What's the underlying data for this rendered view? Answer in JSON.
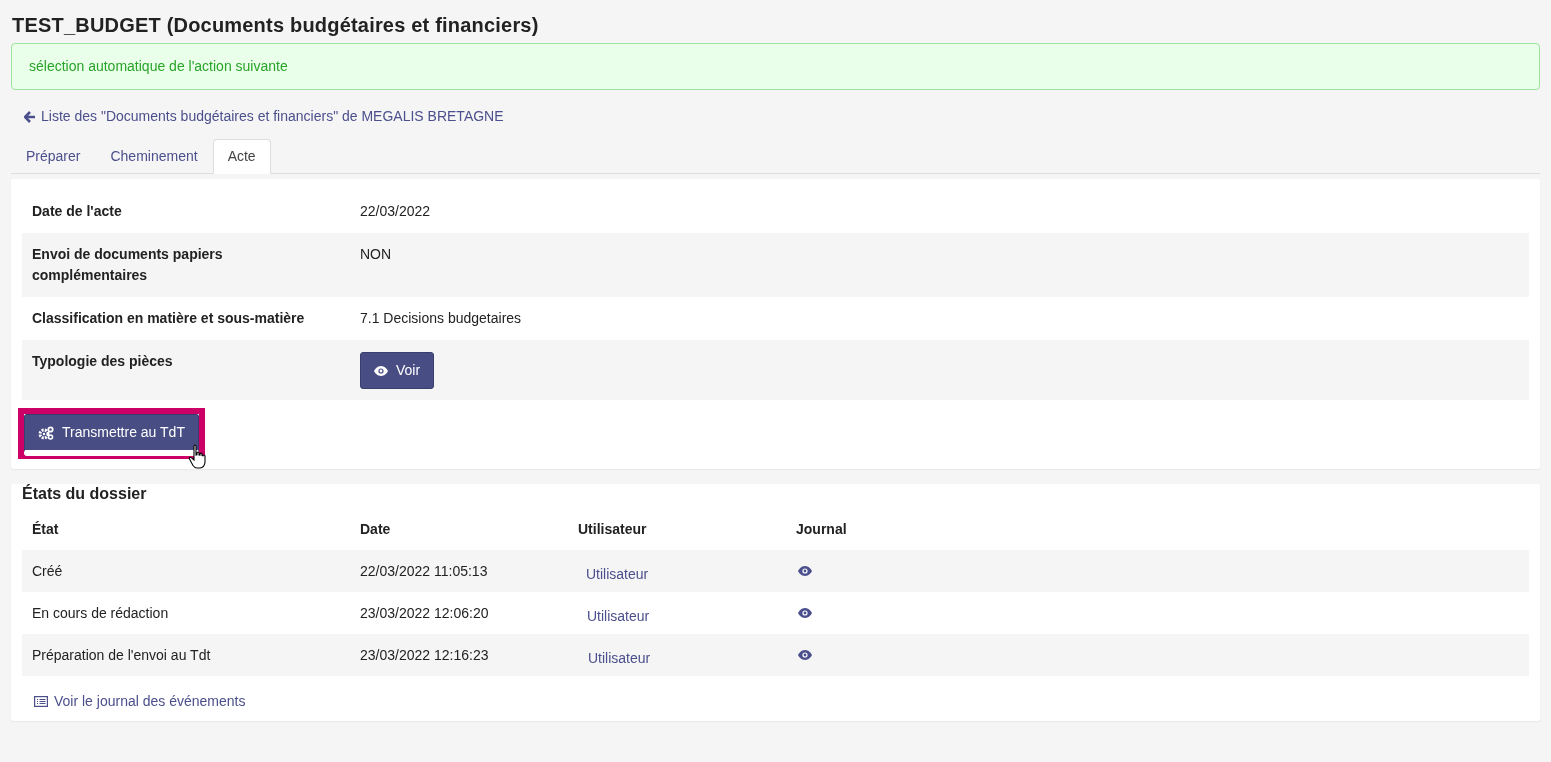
{
  "title": "TEST_BUDGET (Documents budgétaires et financiers)",
  "alert": "sélection automatique de l'action suivante",
  "back_link": "Liste des \"Documents budgétaires et financiers\" de MEGALIS BRETAGNE",
  "tabs": [
    {
      "label": "Préparer",
      "selected": false
    },
    {
      "label": "Cheminement",
      "selected": false
    },
    {
      "label": "Acte",
      "selected": true
    }
  ],
  "acte_fields": [
    {
      "kind": "text",
      "label": "Date de l'acte",
      "value": "22/03/2022"
    },
    {
      "kind": "text",
      "label": "Envoi de documents papiers complémentaires",
      "value": "NON"
    },
    {
      "kind": "text",
      "label": "Classification en matière et sous-matière",
      "value": "7.1 Decisions budgetaires"
    },
    {
      "kind": "button",
      "label": "Typologie des pièces",
      "value": "Voir"
    }
  ],
  "action_button": {
    "label": "Transmettre au TdT",
    "highlighted": true
  },
  "states": {
    "title": "États du dossier",
    "columns": [
      "État",
      "Date",
      "Utilisateur",
      "Journal"
    ],
    "rows": [
      {
        "etat": "Créé",
        "date": "22/03/2022 11:05:13",
        "user": "Utilisateur"
      },
      {
        "etat": "En cours de rédaction",
        "date": "23/03/2022 12:06:20",
        "user": "Utilisateur"
      },
      {
        "etat": "Préparation de l'envoi au Tdt",
        "date": "23/03/2022 12:16:23",
        "user": "Utilisateur"
      }
    ]
  },
  "journal_link": "Voir le journal des événements"
}
